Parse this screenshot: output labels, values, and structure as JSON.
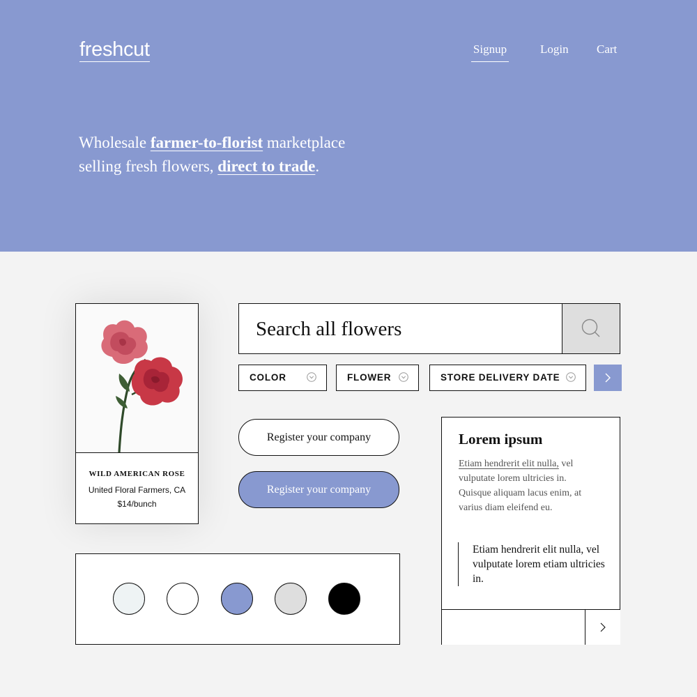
{
  "header": {
    "logo": "freshcut",
    "nav": {
      "signup": "Signup",
      "login": "Login",
      "cart": "Cart"
    }
  },
  "hero": {
    "t1": "Wholesale ",
    "l1": "farmer-to-florist",
    "t2": " marketplace",
    "t3": "selling fresh flowers, ",
    "l2": "direct to trade",
    "t4": "."
  },
  "product": {
    "name": "WILD AMERICAN ROSE",
    "farm": "United Floral Farmers, CA",
    "price": "$14/bunch"
  },
  "search": {
    "placeholder": "Search all flowers"
  },
  "filters": {
    "color": "COLOR",
    "flower": "FLOWER",
    "delivery": "STORE DELIVERY DATE"
  },
  "buttons": {
    "register_outline": "Register your company",
    "register_filled": "Register your company"
  },
  "swatches": [
    "#eef3f4",
    "#ffffff",
    "#8899d0",
    "#dedede",
    "#000000"
  ],
  "card": {
    "title": "Lorem ipsum",
    "link": "Etiam hendrerit elit nulla,",
    "body_rest": " vel vulputate lorem ultricies in. Quisque aliquam lacus enim, at varius diam eleifend eu.",
    "quote": "Etiam hendrerit elit nulla, vel vulputate lorem etiam ultricies in."
  },
  "colors": {
    "accent": "#8899d0",
    "background": "#f3f3f3",
    "border": "#111111"
  },
  "icons": [
    "search-icon",
    "chevron-down-icon",
    "chevron-right-icon"
  ]
}
